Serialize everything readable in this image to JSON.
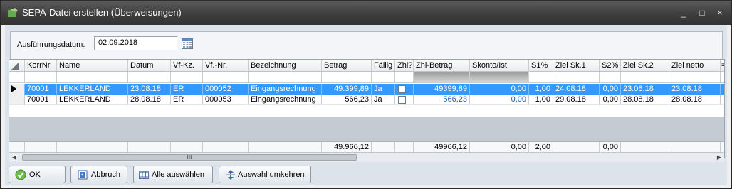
{
  "window": {
    "title": "SEPA-Datei erstellen (Überweisungen)",
    "controls": [
      "_",
      "□",
      "×"
    ]
  },
  "form": {
    "date_label": "Ausführungsdatum:",
    "date_value": "02.09.2018"
  },
  "grid": {
    "columns": [
      "KorrNr",
      "Name",
      "Datum",
      "Vf-Kz.",
      "Vf.-Nr.",
      "Bezeichnung",
      "Betrag",
      "Fällig",
      "Zhl?",
      "Zhl-Betrag",
      "Skonto/Ist",
      "S1%",
      "Ziel Sk.1",
      "S2%",
      "Ziel Sk.2",
      "Ziel netto",
      "=>"
    ],
    "rows": [
      {
        "korrnr": "70001",
        "name": "LEKKERLAND",
        "datum": "23.08.18",
        "vfkz": "ER",
        "vfnr": "000052",
        "bezeichnung": "Eingangsrechnung",
        "betrag": "49.399,89",
        "faellig": "Ja",
        "zhl_betrag": "49399,89",
        "skonto": "0,00",
        "s1": "1,00",
        "ziel_sk1": "24.08.18",
        "s2": "0,00",
        "ziel_sk2": "23.08.18",
        "ziel_netto": "23.08.18"
      },
      {
        "korrnr": "70001",
        "name": "LEKKERLAND",
        "datum": "28.08.18",
        "vfkz": "ER",
        "vfnr": "000053",
        "bezeichnung": "Eingangsrechnung",
        "betrag": "566,23",
        "faellig": "Ja",
        "zhl_betrag": "566,23",
        "skonto": "0,00",
        "s1": "1,00",
        "ziel_sk1": "29.08.18",
        "s2": "0,00",
        "ziel_sk2": "28.08.18",
        "ziel_netto": "28.08.18"
      }
    ],
    "sums": {
      "betrag": "49.966,12",
      "zhl_betrag": "49966,12",
      "skonto": "0,00",
      "s1": "2,00",
      "s2": "0,00"
    },
    "scroll_thumb_label": "III"
  },
  "buttons": {
    "ok": "OK",
    "abbruch": "Abbruch",
    "alle": "Alle auswählen",
    "umkehren": "Auswahl umkehren"
  },
  "colors": {
    "selection": "#3399ff",
    "value_blue": "#1f5fb3"
  }
}
